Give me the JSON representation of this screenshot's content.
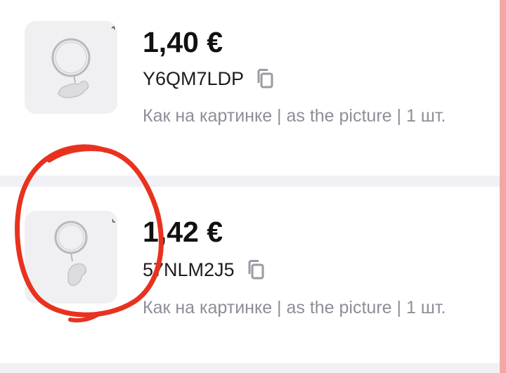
{
  "items": [
    {
      "price": "1,40 €",
      "sku": "Y6QM7LDP",
      "description": "Как на картинке | as the picture | 1 шт.",
      "copy_icon": "copy-icon",
      "thumbnail_icon": "keyring-product-image"
    },
    {
      "price": "1,42 €",
      "sku": "57NLM2J5",
      "description": "Как на картинке | as the picture | 1 шт.",
      "copy_icon": "copy-icon",
      "thumbnail_icon": "keyring-product-image"
    }
  ],
  "colors": {
    "price_text": "#111111",
    "description_text": "#8e8e98",
    "thumbnail_bg": "#f0f0f3",
    "divider": "#f1f1f5",
    "annotation_circle": "#e8321f",
    "right_edge": "#f3a6a4"
  }
}
